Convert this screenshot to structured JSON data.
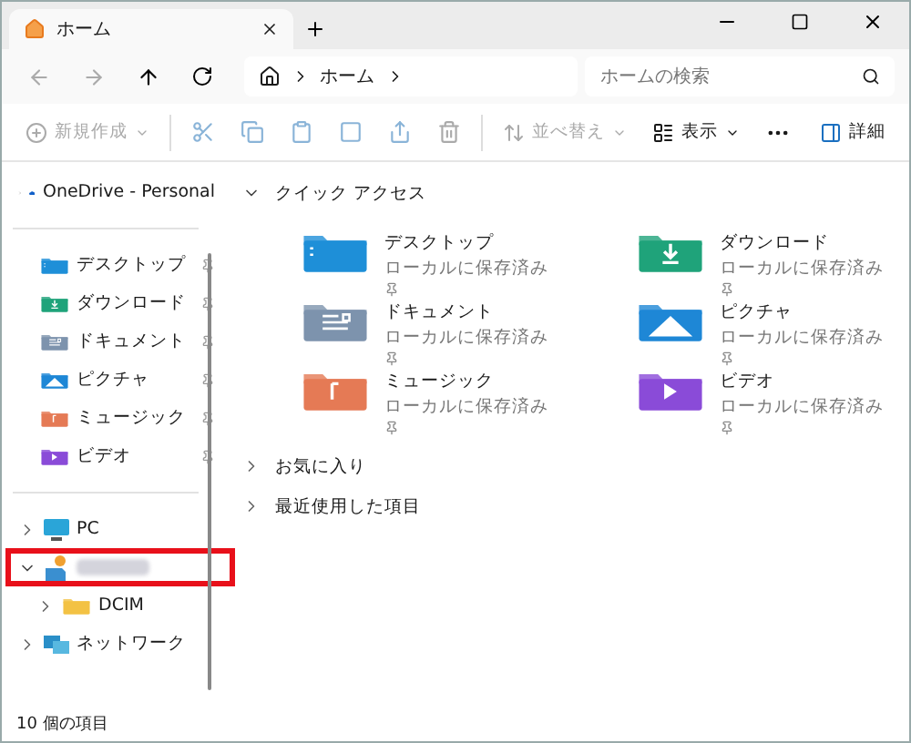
{
  "tabs": [
    {
      "label": "ホーム",
      "selected": true
    }
  ],
  "address": {
    "crumbs": [
      "ホーム"
    ]
  },
  "search": {
    "placeholder": "ホームの検索"
  },
  "toolbar": {
    "new_label": "新規作成",
    "sort_label": "並べ替え",
    "view_label": "表示",
    "details_label": "詳細"
  },
  "sidebar": {
    "top": [
      {
        "label": "OneDrive - Personal",
        "kind": "cloud"
      }
    ],
    "pinned": [
      {
        "label": "デスクトップ",
        "kind": "desktop"
      },
      {
        "label": "ダウンロード",
        "kind": "download"
      },
      {
        "label": "ドキュメント",
        "kind": "document"
      },
      {
        "label": "ピクチャ",
        "kind": "picture"
      },
      {
        "label": "ミュージック",
        "kind": "music"
      },
      {
        "label": "ビデオ",
        "kind": "video"
      }
    ],
    "drives": [
      {
        "label": "PC",
        "kind": "pc",
        "expanded": false,
        "highlighted": false
      },
      {
        "kind": "sd",
        "expanded": true,
        "highlighted": true,
        "children": [
          {
            "label": "DCIM",
            "kind": "folder",
            "expanded": false
          }
        ]
      },
      {
        "label": "ネットワーク",
        "kind": "network",
        "expanded": false,
        "highlighted": false
      }
    ]
  },
  "sections": [
    {
      "title": "クイック アクセス",
      "expanded": true,
      "items": [
        {
          "name": "デスクトップ",
          "status": "ローカルに保存済み",
          "kind": "desktop"
        },
        {
          "name": "ダウンロード",
          "status": "ローカルに保存済み",
          "kind": "download"
        },
        {
          "name": "ドキュメント",
          "status": "ローカルに保存済み",
          "kind": "document"
        },
        {
          "name": "ピクチャ",
          "status": "ローカルに保存済み",
          "kind": "picture"
        },
        {
          "name": "ミュージック",
          "status": "ローカルに保存済み",
          "kind": "music"
        },
        {
          "name": "ビデオ",
          "status": "ローカルに保存済み",
          "kind": "video"
        }
      ]
    },
    {
      "title": "お気に入り",
      "expanded": false
    },
    {
      "title": "最近使用した項目",
      "expanded": false
    }
  ],
  "status_bar": "10 個の項目"
}
